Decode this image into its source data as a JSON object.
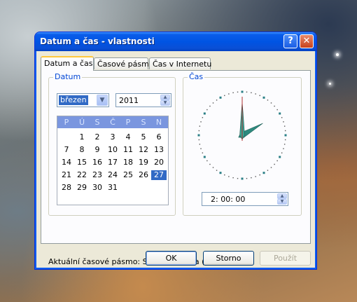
{
  "window": {
    "title": "Datum a čas - vlastnosti",
    "help_label": "?",
    "close_label": "✕"
  },
  "tabs": [
    {
      "label": "Datum a čas",
      "active": true
    },
    {
      "label": "Časové pásmo",
      "active": false
    },
    {
      "label": "Čas v Internetu",
      "active": false
    }
  ],
  "date_group": {
    "label": "Datum",
    "month": "březen",
    "year": "2011",
    "weekdays": [
      "P",
      "Ú",
      "S",
      "Č",
      "P",
      "S",
      "N"
    ],
    "weeks": [
      [
        "",
        "1",
        "2",
        "3",
        "4",
        "5",
        "6"
      ],
      [
        "7",
        "8",
        "9",
        "10",
        "11",
        "12",
        "13"
      ],
      [
        "14",
        "15",
        "16",
        "17",
        "18",
        "19",
        "20"
      ],
      [
        "21",
        "22",
        "23",
        "24",
        "25",
        "26",
        "27"
      ],
      [
        "28",
        "29",
        "30",
        "31",
        "",
        "",
        ""
      ]
    ],
    "selected_day": "27"
  },
  "time_group": {
    "label": "Čas",
    "time": "2: 00: 00",
    "hour": 2,
    "minute": 0,
    "second": 0
  },
  "timezone_text": "Aktuální časové pásmo:  Střední Evropa (běžný čas)",
  "buttons": {
    "ok": "OK",
    "cancel": "Storno",
    "apply": "Použít"
  },
  "colors": {
    "titlebar": "#0054e3",
    "selection": "#316ac5",
    "group_label": "#0046d5",
    "clock_hands": "#2e8b7f"
  }
}
